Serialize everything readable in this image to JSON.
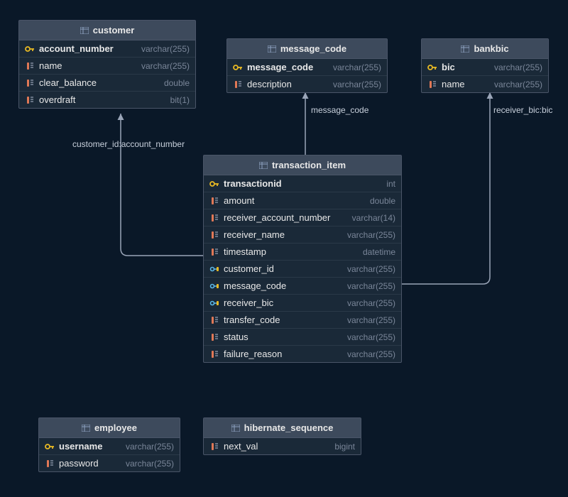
{
  "tables": {
    "customer": {
      "name": "customer",
      "columns": [
        {
          "name": "account_number",
          "type": "varchar(255)",
          "icon": "pk"
        },
        {
          "name": "name",
          "type": "varchar(255)",
          "icon": "col"
        },
        {
          "name": "clear_balance",
          "type": "double",
          "icon": "col"
        },
        {
          "name": "overdraft",
          "type": "bit(1)",
          "icon": "col"
        }
      ]
    },
    "message_code": {
      "name": "message_code",
      "columns": [
        {
          "name": "message_code",
          "type": "varchar(255)",
          "icon": "pk"
        },
        {
          "name": "description",
          "type": "varchar(255)",
          "icon": "col"
        }
      ]
    },
    "bankbic": {
      "name": "bankbic",
      "columns": [
        {
          "name": "bic",
          "type": "varchar(255)",
          "icon": "pk"
        },
        {
          "name": "name",
          "type": "varchar(255)",
          "icon": "col"
        }
      ]
    },
    "transaction_item": {
      "name": "transaction_item",
      "columns": [
        {
          "name": "transactionid",
          "type": "int",
          "icon": "pk"
        },
        {
          "name": "amount",
          "type": "double",
          "icon": "col"
        },
        {
          "name": "receiver_account_number",
          "type": "varchar(14)",
          "icon": "col"
        },
        {
          "name": "receiver_name",
          "type": "varchar(255)",
          "icon": "col"
        },
        {
          "name": "timestamp",
          "type": "datetime",
          "icon": "col"
        },
        {
          "name": "customer_id",
          "type": "varchar(255)",
          "icon": "fk"
        },
        {
          "name": "message_code",
          "type": "varchar(255)",
          "icon": "fk"
        },
        {
          "name": "receiver_bic",
          "type": "varchar(255)",
          "icon": "fk"
        },
        {
          "name": "transfer_code",
          "type": "varchar(255)",
          "icon": "col"
        },
        {
          "name": "status",
          "type": "varchar(255)",
          "icon": "col"
        },
        {
          "name": "failure_reason",
          "type": "varchar(255)",
          "icon": "col"
        }
      ]
    },
    "employee": {
      "name": "employee",
      "columns": [
        {
          "name": "username",
          "type": "varchar(255)",
          "icon": "pk"
        },
        {
          "name": "password",
          "type": "varchar(255)",
          "icon": "col"
        }
      ]
    },
    "hibernate_sequence": {
      "name": "hibernate_sequence",
      "columns": [
        {
          "name": "next_val",
          "type": "bigint",
          "icon": "col"
        }
      ]
    }
  },
  "relations": {
    "customer_rel": "customer_id:account_number",
    "message_code_rel": "message_code",
    "bankbic_rel": "receiver_bic:bic"
  }
}
